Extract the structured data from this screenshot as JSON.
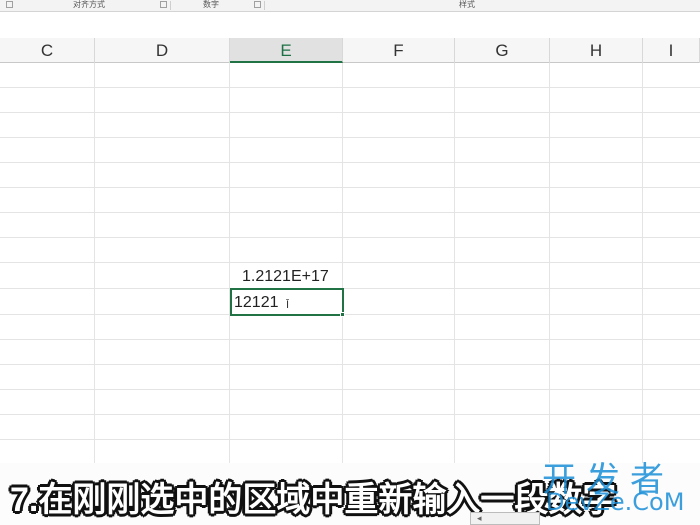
{
  "ribbon": {
    "groups": [
      {
        "label": "对齐方式"
      },
      {
        "label": "数字"
      },
      {
        "label": "样式"
      }
    ]
  },
  "sheet": {
    "columns": [
      "C",
      "D",
      "E",
      "F",
      "G",
      "H",
      "I"
    ],
    "active_column": "E",
    "cells": {
      "e_upper": "1.2121E+17",
      "active_value": "12121"
    }
  },
  "caption": {
    "text": "7.在刚刚选中的区域中重新输入一段数字"
  },
  "watermark": {
    "line1": "开发者",
    "line2": "DevZe.CoM"
  },
  "colors": {
    "accent": "#217346",
    "watermark": "#1b8fd8"
  }
}
